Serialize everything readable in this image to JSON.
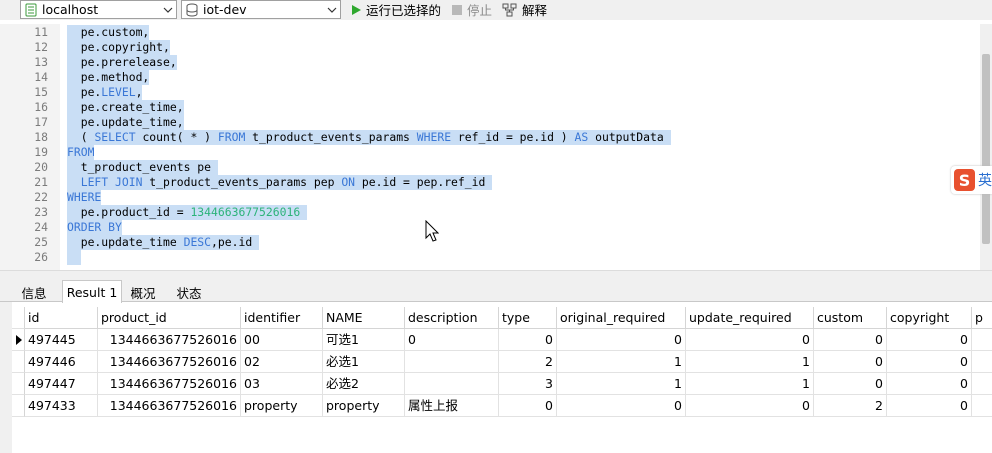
{
  "toolbar": {
    "connection": "localhost",
    "database": "iot-dev",
    "run_selected": "运行已选择的",
    "stop": "停止",
    "explain": "解释"
  },
  "editor": {
    "lines": [
      {
        "n": "11",
        "sel": true,
        "parts": [
          {
            "t": "  pe.custom,"
          }
        ]
      },
      {
        "n": "12",
        "sel": true,
        "parts": [
          {
            "t": "  pe.copyright,"
          }
        ]
      },
      {
        "n": "13",
        "sel": true,
        "parts": [
          {
            "t": "  pe.prerelease,"
          }
        ]
      },
      {
        "n": "14",
        "sel": true,
        "parts": [
          {
            "t": "  pe.method,"
          }
        ]
      },
      {
        "n": "15",
        "sel": true,
        "parts": [
          {
            "t": "  pe."
          },
          {
            "t": "LEVEL",
            "c": "kw"
          },
          {
            "t": ","
          }
        ]
      },
      {
        "n": "16",
        "sel": true,
        "parts": [
          {
            "t": "  pe.create_time,"
          }
        ]
      },
      {
        "n": "17",
        "sel": true,
        "parts": [
          {
            "t": "  pe.update_time,"
          }
        ]
      },
      {
        "n": "18",
        "sel": true,
        "parts": [
          {
            "t": "  ( "
          },
          {
            "t": "SELECT",
            "c": "kw"
          },
          {
            "t": " count( * ) "
          },
          {
            "t": "FROM",
            "c": "kw"
          },
          {
            "t": " t_product_events_params "
          },
          {
            "t": "WHERE",
            "c": "kw"
          },
          {
            "t": " ref_id = pe.id ) "
          },
          {
            "t": "AS",
            "c": "kw"
          },
          {
            "t": " outputData "
          }
        ]
      },
      {
        "n": "19",
        "sel": true,
        "parts": [
          {
            "t": "FROM",
            "c": "kw"
          }
        ]
      },
      {
        "n": "20",
        "sel": true,
        "parts": [
          {
            "t": "  t_product_events pe "
          }
        ]
      },
      {
        "n": "21",
        "sel": true,
        "parts": [
          {
            "t": "  "
          },
          {
            "t": "LEFT JOIN",
            "c": "kw"
          },
          {
            "t": " t_product_events_params pep "
          },
          {
            "t": "ON",
            "c": "kw"
          },
          {
            "t": " pe.id = pep.ref_id "
          }
        ]
      },
      {
        "n": "22",
        "sel": true,
        "parts": [
          {
            "t": "WHERE",
            "c": "kw"
          }
        ]
      },
      {
        "n": "23",
        "sel": true,
        "parts": [
          {
            "t": "  pe.product_id = "
          },
          {
            "t": "1344663677526016",
            "c": "num"
          },
          {
            "t": " "
          }
        ]
      },
      {
        "n": "24",
        "sel": true,
        "parts": [
          {
            "t": "ORDER BY",
            "c": "kw"
          }
        ]
      },
      {
        "n": "25",
        "sel": true,
        "parts": [
          {
            "t": "  pe.update_time "
          },
          {
            "t": "DESC",
            "c": "kw"
          },
          {
            "t": ",pe.id "
          }
        ]
      },
      {
        "n": "26",
        "sel": true,
        "parts": [
          {
            "t": "  "
          }
        ]
      }
    ],
    "ime_char": "英"
  },
  "tabs": [
    {
      "label": "信息",
      "active": false
    },
    {
      "label": "Result 1",
      "active": true
    },
    {
      "label": "概况",
      "active": false
    },
    {
      "label": "状态",
      "active": false
    }
  ],
  "grid": {
    "columns": [
      "id",
      "product_id",
      "identifier",
      "NAME",
      "description",
      "type",
      "original_required",
      "update_required",
      "custom",
      "copyright",
      "p"
    ],
    "rows": [
      [
        "497445",
        "1344663677526016",
        "00",
        "可选1",
        "0",
        "0",
        "0",
        "0",
        "0",
        "0",
        ""
      ],
      [
        "497446",
        "1344663677526016",
        "02",
        "必选1",
        "",
        "2",
        "1",
        "1",
        "0",
        "0",
        ""
      ],
      [
        "497447",
        "1344663677526016",
        "03",
        "必选2",
        "",
        "3",
        "1",
        "1",
        "0",
        "0",
        ""
      ],
      [
        "497433",
        "1344663677526016",
        "property",
        "property",
        "属性上报",
        "0",
        "0",
        "0",
        "2",
        "0",
        ""
      ]
    ]
  }
}
